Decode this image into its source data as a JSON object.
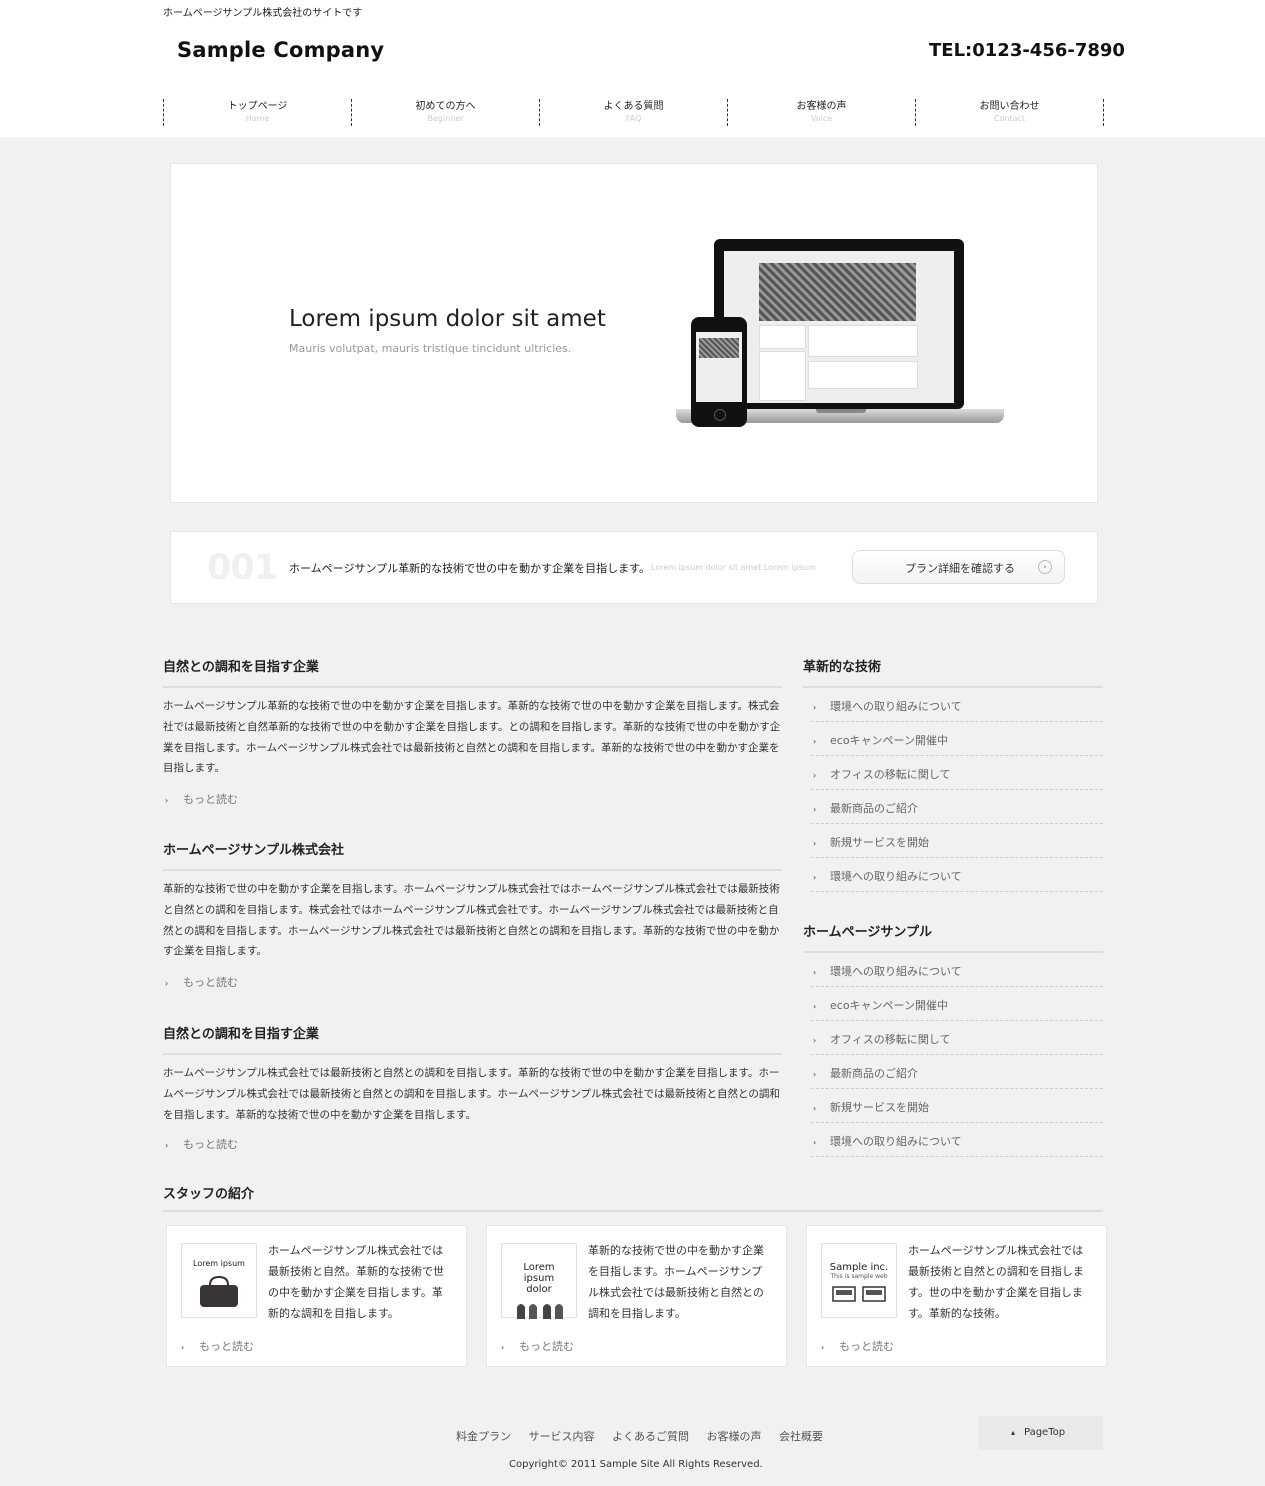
{
  "header": {
    "tagline": "ホームページサンプル株式会社のサイトです",
    "logo": "Sample Company",
    "tel": "TEL:0123-456-7890"
  },
  "nav": [
    {
      "jp": "トップページ",
      "en": "Home"
    },
    {
      "jp": "初めての方へ",
      "en": "Beginner"
    },
    {
      "jp": "よくある質問",
      "en": "FAQ"
    },
    {
      "jp": "お客様の声",
      "en": "Voice"
    },
    {
      "jp": "お問い合わせ",
      "en": "Contact"
    }
  ],
  "hero": {
    "title": "Lorem ipsum dolor sit amet",
    "subtitle": "Mauris volutpat, mauris tristique tincidunt ultricies."
  },
  "plan": {
    "number": "001",
    "text": "ホームページサンプル革新的な技術で世の中を動かす企業を目指します。",
    "lorem": "Lorem Ipsum dolor sit amet Lorem ipsum",
    "button": "プラン詳細を確認する",
    "button_icon": "›"
  },
  "more_label": "もっと読む",
  "articles": [
    {
      "title": "自然との調和を目指す企業",
      "body": "ホームページサンプル革新的な技術で世の中を動かす企業を目指します。革新的な技術で世の中を動かす企業を目指します。株式会社では最新技術と自然革新的な技術で世の中を動かす企業を目指します。との調和を目指します。革新的な技術で世の中を動かす企業を目指します。ホームページサンプル株式会社では最新技術と自然との調和を目指します。革新的な技術で世の中を動かす企業を目指します。"
    },
    {
      "title": "ホームページサンプル株式会社",
      "body": "革新的な技術で世の中を動かす企業を目指します。ホームページサンプル株式会社ではホームページサンプル株式会社では最新技術と自然との調和を目指します。株式会社ではホームページサンプル株式会社です。ホームページサンプル株式会社では最新技術と自然との調和を目指します。ホームページサンプル株式会社では最新技術と自然との調和を目指します。革新的な技術で世の中を動かす企業を目指します。"
    },
    {
      "title": "自然との調和を目指す企業",
      "body": "ホームページサンプル株式会社では最新技術と自然との調和を目指します。革新的な技術で世の中を動かす企業を目指します。ホームページサンプル株式会社では最新技術と自然との調和を目指します。ホームページサンプル株式会社では最新技術と自然との調和を目指します。革新的な技術で世の中を動かす企業を目指します。"
    }
  ],
  "sidebar": [
    {
      "title": "革新的な技術",
      "items": [
        "環境への取り組みについて",
        "ecoキャンペーン開催中",
        "オフィスの移転に関して",
        "最新商品のご紹介",
        "新規サービスを開始",
        "環境への取り組みについて"
      ]
    },
    {
      "title": "ホームページサンプル",
      "items": [
        "環境への取り組みについて",
        "ecoキャンペーン開催中",
        "オフィスの移転に関して",
        "最新商品のご紹介",
        "新規サービスを開始",
        "環境への取り組みについて"
      ]
    }
  ],
  "staff": {
    "title": "スタッフの紹介",
    "cards": [
      {
        "thumb_caption": "Lorem ipsum",
        "text": "ホームページサンプル株式会社では最新技術と自然。革新的な技術で世の中を動かす企業を目指します。革新的な調和を目指します。"
      },
      {
        "thumb_caption": "Lorem ipsum dolor",
        "text": "革新的な技術で世の中を動かす企業を目指します。ホームページサンプル株式会社では最新技術と自然との調和を目指します。"
      },
      {
        "thumb_caption": "Sample inc.",
        "thumb_sub": "This is sample web",
        "text": "ホームページサンプル株式会社では最新技術と自然との調和を目指します。世の中を動かす企業を目指します。革新的な技術。"
      }
    ]
  },
  "footer": {
    "links": [
      "料金プラン",
      "サービス内容",
      "よくあるご質問",
      "お客様の声",
      "会社概要"
    ],
    "copyright": "Copyright© 2011 Sample Site All Rights Reserved.",
    "pagetop": "PageTop"
  }
}
